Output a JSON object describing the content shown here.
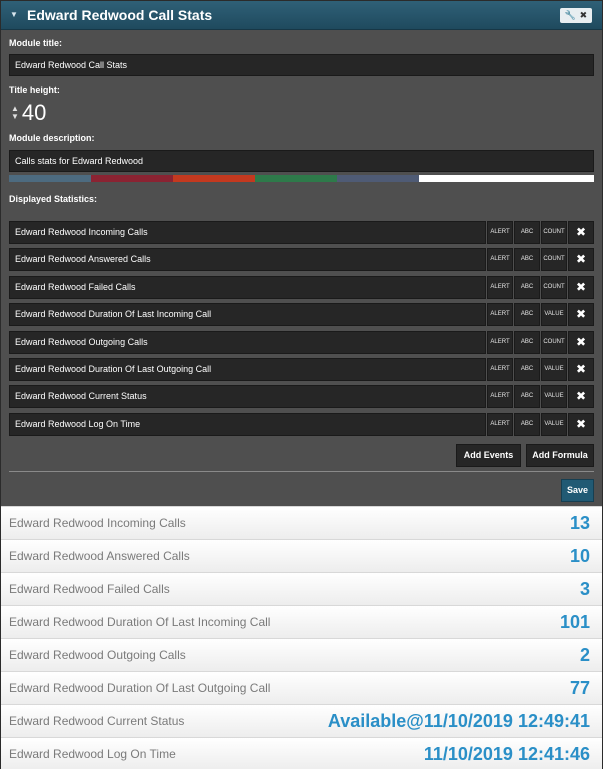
{
  "window": {
    "title": "Edward Redwood Call Stats",
    "collapse_icon": "triangle-down-icon",
    "tool_icons": [
      "wrench-icon",
      "close-icon"
    ]
  },
  "form": {
    "module_title_label": "Module title:",
    "module_title_value": "Edward Redwood Call Stats",
    "title_height_label": "Title height:",
    "title_height_value": "40",
    "module_description_label": "Module description:",
    "module_description_value": "Calls stats for Edward Redwood",
    "color_strip": [
      "#4d6b80",
      "#8b2332",
      "#c4391f",
      "#2e7a4a",
      "#4f5b75",
      "#ffffff"
    ],
    "displayed_statistics_label": "Displayed Statistics:"
  },
  "statistics": [
    {
      "name": "Edward Redwood Incoming Calls",
      "alert": "ALERT",
      "abc": "ABC",
      "mode": "COUNT"
    },
    {
      "name": "Edward Redwood Answered Calls",
      "alert": "ALERT",
      "abc": "ABC",
      "mode": "COUNT"
    },
    {
      "name": "Edward Redwood Failed Calls",
      "alert": "ALERT",
      "abc": "ABC",
      "mode": "COUNT"
    },
    {
      "name": "Edward Redwood Duration Of Last Incoming Call",
      "alert": "ALERT",
      "abc": "ABC",
      "mode": "VALUE"
    },
    {
      "name": "Edward Redwood Outgoing Calls",
      "alert": "ALERT",
      "abc": "ABC",
      "mode": "COUNT"
    },
    {
      "name": "Edward Redwood Duration Of Last Outgoing Call",
      "alert": "ALERT",
      "abc": "ABC",
      "mode": "VALUE"
    },
    {
      "name": "Edward Redwood Current Status",
      "alert": "ALERT",
      "abc": "ABC",
      "mode": "VALUE"
    },
    {
      "name": "Edward Redwood Log On Time",
      "alert": "ALERT",
      "abc": "ABC",
      "mode": "VALUE"
    }
  ],
  "actions": {
    "add_events": "Add Events",
    "add_formula": "Add Formula",
    "save": "Save"
  },
  "results": [
    {
      "name": "Edward Redwood Incoming Calls",
      "value": "13"
    },
    {
      "name": "Edward Redwood Answered Calls",
      "value": "10"
    },
    {
      "name": "Edward Redwood Failed Calls",
      "value": "3"
    },
    {
      "name": "Edward Redwood Duration Of Last Incoming Call",
      "value": "101"
    },
    {
      "name": "Edward Redwood Outgoing Calls",
      "value": "2"
    },
    {
      "name": "Edward Redwood Duration Of Last Outgoing Call",
      "value": "77"
    },
    {
      "name": "Edward Redwood Current Status",
      "value": "Available@11/10/2019 12:49:41"
    },
    {
      "name": "Edward Redwood Log On Time",
      "value": "11/10/2019 12:41:46"
    }
  ]
}
